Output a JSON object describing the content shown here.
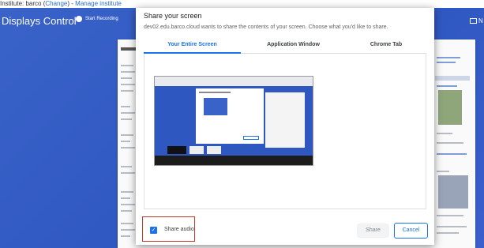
{
  "topbar": {
    "prefix": "Institute: barco (",
    "change_link": "Change",
    "mid": ") - ",
    "manage_link": "Manage institute"
  },
  "app": {
    "title": "Displays Control",
    "record_label": "Start Recording",
    "monitor_label": "N"
  },
  "dialog": {
    "title": "Share your screen",
    "subtitle": "dev02.edu.barco.cloud wants to share the contents of your screen. Choose what you'd like to share.",
    "tabs": [
      {
        "label": "Your Entire Screen",
        "active": true
      },
      {
        "label": "Application Window",
        "active": false
      },
      {
        "label": "Chrome Tab",
        "active": false
      }
    ],
    "share_audio": {
      "label": "Share audio",
      "checked": true
    },
    "share_button": "Share",
    "cancel_button": "Cancel"
  },
  "colors": {
    "accent": "#1a73e8",
    "app_background": "#3a63c9",
    "highlight_border": "#c0392b"
  }
}
